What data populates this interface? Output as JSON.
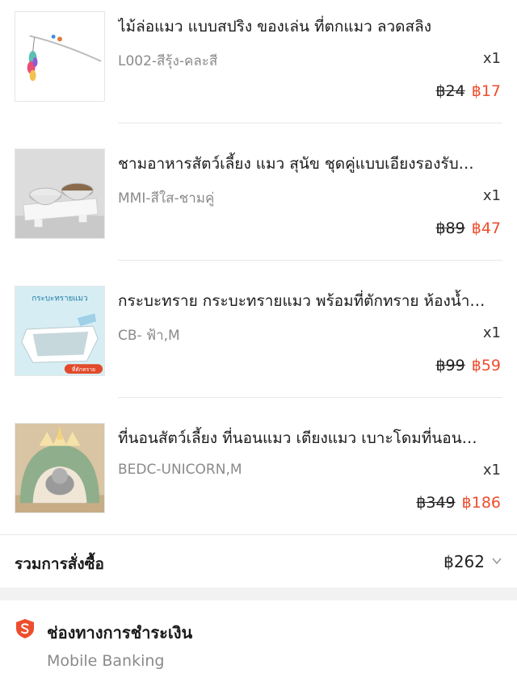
{
  "items": [
    {
      "title": "ไม้ล่อแมว แบบสปริง ของเล่น ที่ตกแมว ลวดสลิง",
      "variant": "L002-สีรุ้ง-คละสี",
      "qty": "x1",
      "old_price": "฿24",
      "new_price": "฿17"
    },
    {
      "title": "ชามอาหารสัตว์เลี้ยง แมว สุนัข ชุดคู่แบบเอียงรองรับ…",
      "variant": "MMI-สีใส-ชามคู่",
      "qty": "x1",
      "old_price": "฿89",
      "new_price": "฿47"
    },
    {
      "title": "กระบะทราย กระบะทรายแมว พร้อมที่ตักทราย ห้องน้ำ…",
      "variant": "CB- ฟ้า,M",
      "qty": "x1",
      "old_price": "฿99",
      "new_price": "฿59",
      "thumb_text": "กระบะทรายแมว",
      "thumb_badge": "ที่ตักทราย"
    },
    {
      "title": "ที่นอนสัตว์เลี้ยง ที่นอนแมว เตียงแมว เบาะโดมที่นอน…",
      "variant": "BEDC-UNICORN,M",
      "qty": "x1",
      "old_price": "฿349",
      "new_price": "฿186"
    }
  ],
  "summary": {
    "label": "รวมการสั่งซื้อ",
    "total": "฿262"
  },
  "payment": {
    "title": "ช่องทางการชำระเงิน",
    "method": "Mobile Banking"
  },
  "colors": {
    "accent": "#ee4d2d",
    "muted": "#8a8a8a",
    "divider": "#e8e8e8"
  }
}
